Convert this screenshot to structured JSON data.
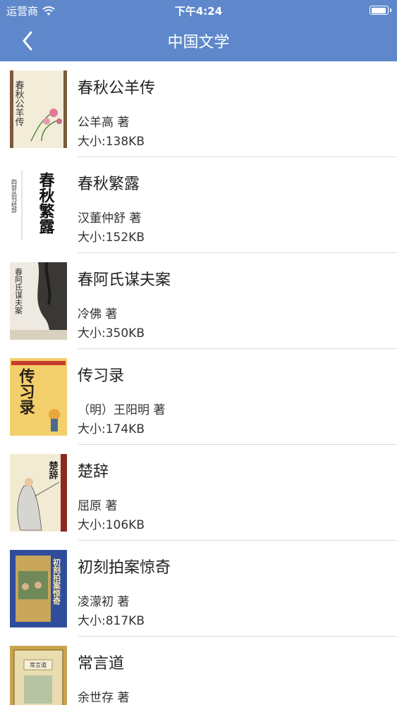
{
  "status_bar": {
    "carrier": "运营商",
    "time": "下午4:24"
  },
  "nav": {
    "title": "中国文学",
    "back_icon": "chevron-left-icon"
  },
  "books": [
    {
      "title": "春秋公羊传",
      "author": "公羊高 著",
      "size": "大小:138KB",
      "cover_text": "春秋公羊传"
    },
    {
      "title": "春秋繁露",
      "author": "汉董仲舒 著",
      "size": "大小:152KB",
      "cover_text": "春秋繁露",
      "cover_side_text": "四部丛刊经部"
    },
    {
      "title": "春阿氏谋夫案",
      "author": "冷佛 著",
      "size": "大小:350KB",
      "cover_text": "春阿氏谋夫案"
    },
    {
      "title": "传习录",
      "author": "（明）王阳明 著",
      "size": "大小:174KB",
      "cover_text": "传习录"
    },
    {
      "title": "楚辞",
      "author": "屈原 著",
      "size": "大小:106KB",
      "cover_text": "楚辞"
    },
    {
      "title": "初刻拍案惊奇",
      "author": "凌濛初 著",
      "size": "大小:817KB",
      "cover_text": "初刻拍案惊奇"
    },
    {
      "title": "常言道",
      "author": "余世存 著",
      "size": "",
      "cover_text": "常言道"
    }
  ]
}
